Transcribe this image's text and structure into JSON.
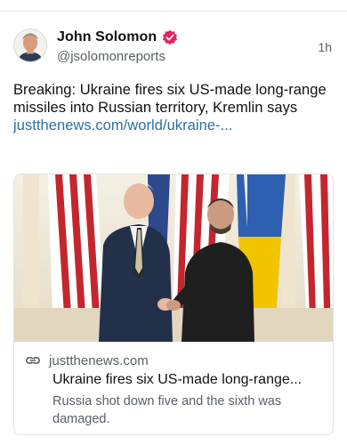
{
  "post": {
    "author_name": "John Solomon",
    "author_handle": "@jsolomonreports",
    "timestamp": "1h",
    "text_before_link": "Breaking: Ukraine fires six US-made long-range missiles into Russian territory, Kremlin says ",
    "link_text": "justthenews.com/world/ukraine-...",
    "accent_color": "#e0245e"
  },
  "link_card": {
    "domain": "justthenews.com",
    "title": "Ukraine fires six US-made long-range...",
    "description": "Russia shot down five and the sixth was damaged."
  },
  "icons": {
    "verified": "verified-badge-icon",
    "link": "link-icon"
  }
}
